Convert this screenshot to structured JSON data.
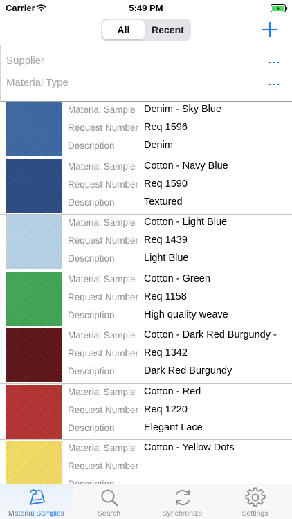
{
  "status_bar": {
    "carrier": "Carrier",
    "time": "5:49 PM"
  },
  "nav": {
    "segments": [
      {
        "label": "All",
        "selected": true
      },
      {
        "label": "Recent",
        "selected": false
      }
    ],
    "add_icon": "plus-icon"
  },
  "filters": [
    {
      "label": "Supplier",
      "value": "---"
    },
    {
      "label": "Material Type",
      "value": "---"
    }
  ],
  "field_labels": {
    "material_sample": "Material Sample",
    "request_number": "Request Number",
    "description": "Description"
  },
  "items": [
    {
      "material_sample": "Denim - Sky Blue",
      "request_number": "Req 1596",
      "description": "Denim",
      "swatch_color": "#3a67a3"
    },
    {
      "material_sample": "Cotton - Navy Blue",
      "request_number": "Req 1590",
      "description": "Textured",
      "swatch_color": "#274a83"
    },
    {
      "material_sample": "Cotton - Light Blue",
      "request_number": "Req 1439",
      "description": "Light Blue",
      "swatch_color": "#b8d5ea"
    },
    {
      "material_sample": "Cotton - Green",
      "request_number": "Req 1158",
      "description": "High quality weave",
      "swatch_color": "#3fa653"
    },
    {
      "material_sample": "Cotton - Dark Red Burgundy -",
      "request_number": "Req 1342",
      "description": "Dark Red Burgundy",
      "swatch_color": "#5c1114"
    },
    {
      "material_sample": "Cotton - Red",
      "request_number": "Req 1220",
      "description": "Elegant Lace",
      "swatch_color": "#b4302e"
    },
    {
      "material_sample": "Cotton - Yellow Dots",
      "request_number": "",
      "description": "",
      "swatch_color": "#f7dd62"
    }
  ],
  "tabs": [
    {
      "label": "Material Samples",
      "icon": "fabric-roll-icon",
      "active": true
    },
    {
      "label": "Search",
      "icon": "search-icon",
      "active": false
    },
    {
      "label": "Synchronize",
      "icon": "sync-icon",
      "active": false
    },
    {
      "label": "Settings",
      "icon": "gear-icon",
      "active": false
    }
  ],
  "colors": {
    "accent": "#2f7fd6",
    "label_gray": "#8e8e93",
    "battery_green": "#4cd964"
  }
}
